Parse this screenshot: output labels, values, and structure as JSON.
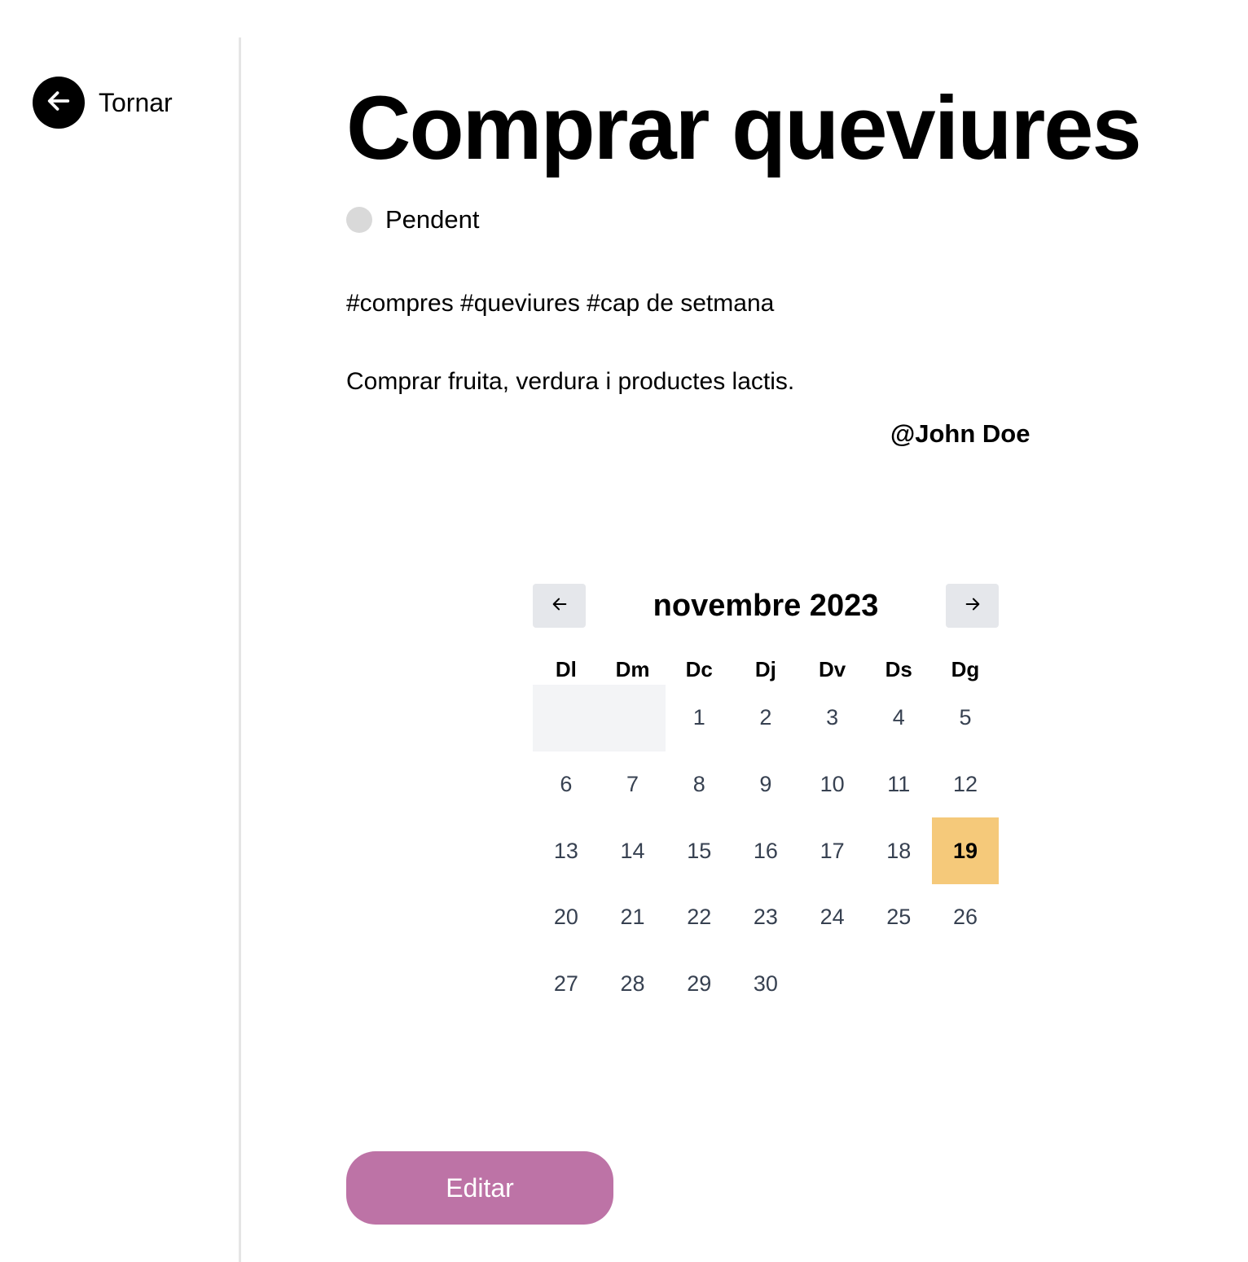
{
  "sidebar": {
    "back_label": "Tornar",
    "back_icon": "arrow-left-icon"
  },
  "task": {
    "title": "Comprar queviures",
    "status": "Pendent",
    "status_color": "#d9d9d9",
    "tags": "#compres #queviures #cap de setmana",
    "description": "Comprar fruita, verdura i productes lactis.",
    "author": "@John Doe"
  },
  "calendar": {
    "month_label": "novembre 2023",
    "prev_icon": "arrow-left-icon",
    "next_icon": "arrow-right-icon",
    "weekdays": [
      "Dl",
      "Dm",
      "Dc",
      "Dj",
      "Dv",
      "Ds",
      "Dg"
    ],
    "leading_empty": 2,
    "days": [
      "1",
      "2",
      "3",
      "4",
      "5",
      "6",
      "7",
      "8",
      "9",
      "10",
      "11",
      "12",
      "13",
      "14",
      "15",
      "16",
      "17",
      "18",
      "19",
      "20",
      "21",
      "22",
      "23",
      "24",
      "25",
      "26",
      "27",
      "28",
      "29",
      "30"
    ],
    "selected_day": "19",
    "selected_color": "#f5c97a"
  },
  "actions": {
    "edit_label": "Editar",
    "edit_color": "#bd73a6"
  }
}
